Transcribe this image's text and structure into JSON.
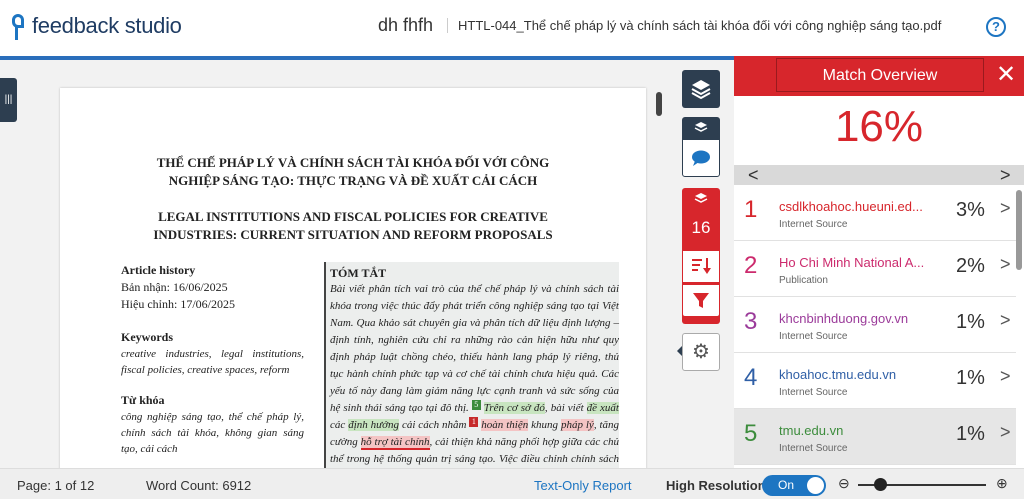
{
  "header": {
    "logo_text": "feedback studio",
    "user": "dh fhfh",
    "document_name": "HTTL-044_Thể chế pháp lý và chính sách tài khóa đối với công nghiệp sáng tạo.pdf",
    "help_icon": "?"
  },
  "document": {
    "title_vn_1": "THỂ CHẾ PHÁP LÝ VÀ CHÍNH SÁCH TÀI KHÓA ĐỐI VỚI CÔNG",
    "title_vn_2": "NGHIỆP SÁNG TẠO: THỰC TRẠNG VÀ ĐỀ XUẤT CẢI CÁCH",
    "title_en_1": "LEGAL INSTITUTIONS AND FISCAL POLICIES FOR CREATIVE",
    "title_en_2": "INDUSTRIES: CURRENT SITUATION AND REFORM PROPOSALS",
    "history_heading": "Article history",
    "received": "Bản nhận: 16/06/2025",
    "revised": "Hiệu chỉnh: 17/06/2025",
    "keywords_heading": "Keywords",
    "keywords": "creative industries, legal institutions, fiscal policies, creative spaces, reform",
    "tukhoa_heading": "Từ khóa",
    "tukhoa": "công nghiệp sáng tạo, thể chế pháp lý, chính sách tài khóa, không gian sáng tạo, cải cách",
    "abstract_heading": "TÓM TẮT",
    "abstract_p1": "Bài viết phân tích vai trò của thể chế pháp lý và chính sách tài khóa trong việc thúc đẩy phát triển công nghiệp sáng tạo tại Việt Nam. Qua khảo sát chuyên gia và phân tích dữ liệu định lượng – định tính, nghiên cứu chỉ ra những rào cản hiện hữu như quy định pháp luật chồng chéo, thiếu hành lang pháp lý riêng, thủ tục hành chính phức tạp và cơ chế tài chính chưa hiệu quả. Các yếu tố này đang làm giảm năng lực cạnh tranh và sức sống của hệ sinh thái sáng tạo tại đô",
    "abstract_p2a": "thị.",
    "mark_g": "5",
    "hl_1": "Trên cơ sở đó",
    "abstract_p2b": ", bài viết",
    "hl_2": "đề xuất",
    "abstract_p2c": "các",
    "hl_3": "định hướng",
    "abstract_p2d": "cải cách",
    "abstract_p3a": "nhằm",
    "mark_r": "1",
    "hl_4": "hoàn thiện",
    "abstract_p3b": "khung",
    "hl_5": "pháp lý",
    "abstract_p3c": ", tăng cường",
    "hl_6": "hỗ trợ tài chính",
    "abstract_p3d": ",",
    "abstract_p4": "cải thiện khả năng phối hợp giữa các chủ thể trong hệ thống quản trị sáng tạo. Việc điều chỉnh chính sách theo hướng"
  },
  "toolbar": {
    "match_count": "16"
  },
  "panel": {
    "title": "Match Overview",
    "close": "✕",
    "overall": "16%",
    "nav_prev": "<",
    "nav_next": ">",
    "sources": [
      {
        "num": "1",
        "name": "csdlkhoahoc.hueuni.ed...",
        "type": "Internet Source",
        "pct": "3%",
        "color": "#d7262c"
      },
      {
        "num": "2",
        "name": "Ho Chi Minh National A...",
        "type": "Publication",
        "pct": "2%",
        "color": "#cc2a6d"
      },
      {
        "num": "3",
        "name": "khcnbinhduong.gov.vn",
        "type": "Internet Source",
        "pct": "1%",
        "color": "#9b3b9a"
      },
      {
        "num": "4",
        "name": "khoahoc.tmu.edu.vn",
        "type": "Internet Source",
        "pct": "1%",
        "color": "#2f5fa6"
      },
      {
        "num": "5",
        "name": "tmu.edu.vn",
        "type": "Internet Source",
        "pct": "1%",
        "color": "#3c8c3c"
      }
    ]
  },
  "footer": {
    "page": "Page: 1 of 12",
    "word_count": "Word Count: 6912",
    "text_only": "Text-Only Report",
    "high_res": "High Resolution",
    "toggle": "On"
  }
}
